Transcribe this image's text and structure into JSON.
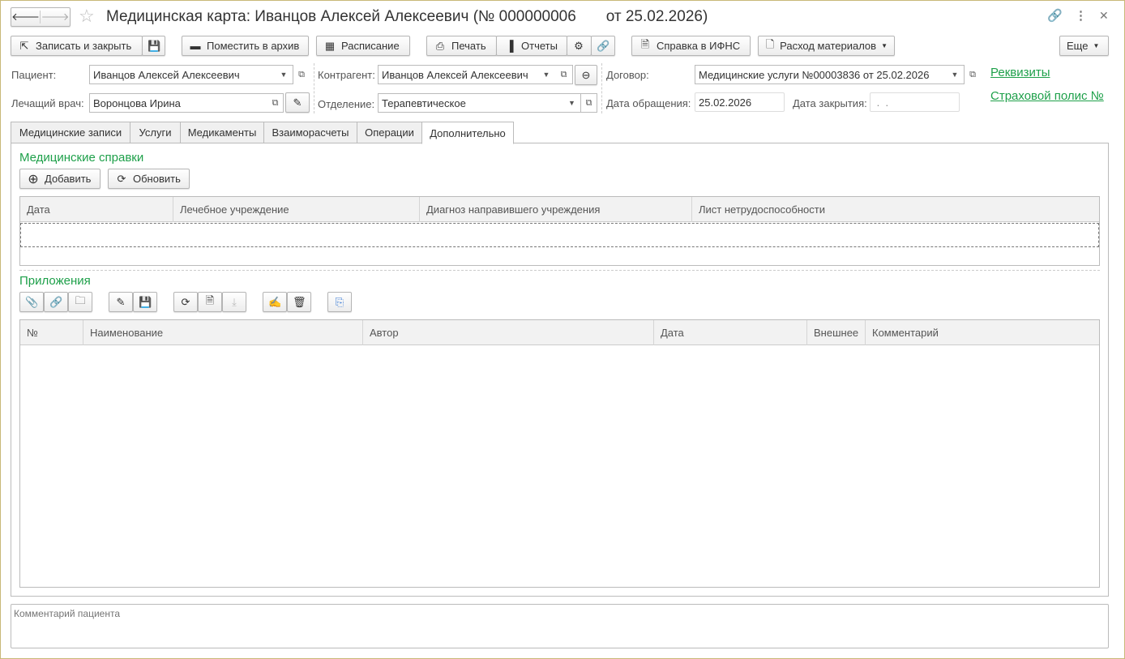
{
  "title": "Медицинская карта: Иванцов Алексей Алексеевич (№ 000000006       от 25.02.2026)",
  "toolbar": {
    "save_close": "Записать и закрыть",
    "archive": "Поместить в архив",
    "schedule": "Расписание",
    "print": "Печать",
    "reports": "Отчеты",
    "ifns": "Справка в ИФНС",
    "materials": "Расход материалов",
    "more": "Еще"
  },
  "fields": {
    "patient_label": "Пациент:",
    "patient": "Иванцов Алексей Алексеевич",
    "doctor_label": "Лечащий врач:",
    "doctor": "Воронцова Ирина",
    "contractor_label": "Контрагент:",
    "contractor": "Иванцов Алексей Алексеевич",
    "department_label": "Отделение:",
    "department": "Терапевтическое",
    "contract_label": "Договор:",
    "contract": "Медицинские услуги №00003836 от 25.02.2026",
    "visit_date_label": "Дата обращения:",
    "visit_date": "25.02.2026",
    "close_date_label": "Дата закрытия:",
    "close_date": " .  .",
    "requisites_link": "Реквизиты",
    "insurance_link": "Страховой полис №"
  },
  "tabs": [
    "Медицинские записи",
    "Услуги",
    "Медикаменты",
    "Взаиморасчеты",
    "Операции",
    "Дополнительно"
  ],
  "certificates": {
    "title": "Медицинские справки",
    "add": "Добавить",
    "refresh": "Обновить",
    "columns": [
      "Дата",
      "Лечебное учреждение",
      "Диагноз направившего учреждения",
      "Лист нетрудоспособности"
    ]
  },
  "attachments": {
    "title": "Приложения",
    "columns": [
      "№",
      "Наименование",
      "Автор",
      "Дата",
      "Внешнее",
      "Комментарий"
    ]
  },
  "comment_placeholder": "Комментарий пациента"
}
